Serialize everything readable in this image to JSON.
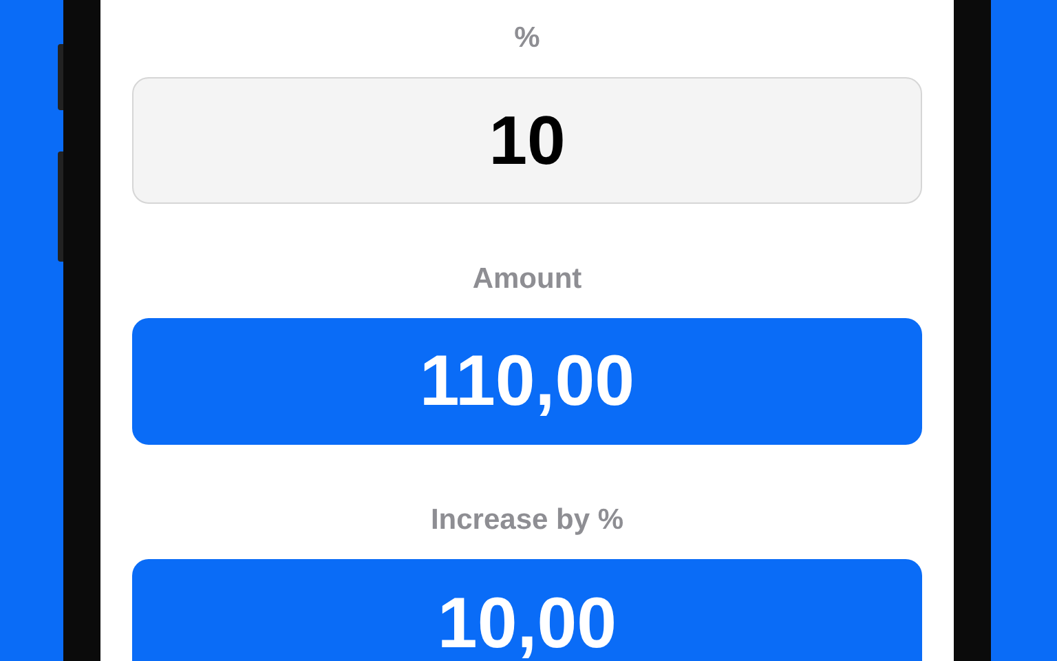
{
  "fields": [
    {
      "label": "%",
      "value": "10",
      "kind": "input"
    },
    {
      "label": "Amount",
      "value": "110,00",
      "kind": "result"
    },
    {
      "label": "Increase by %",
      "value": "10,00",
      "kind": "result"
    }
  ]
}
